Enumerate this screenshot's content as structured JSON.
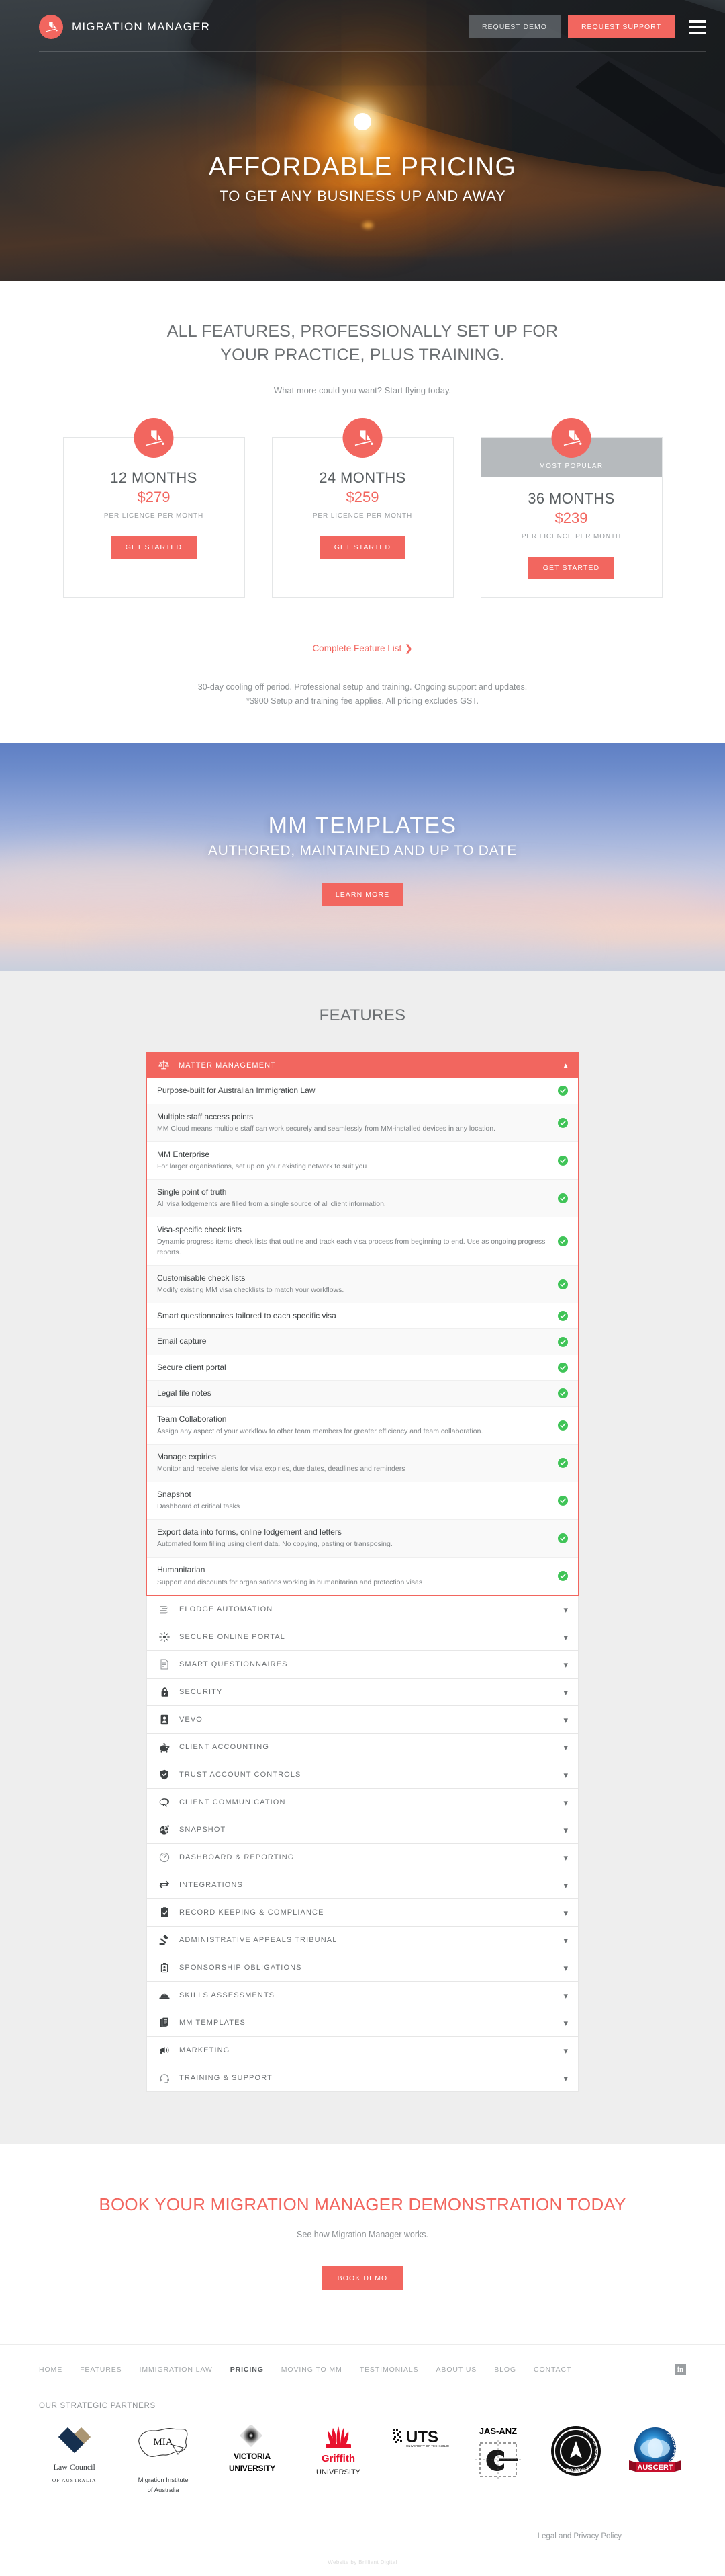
{
  "brand": {
    "name": "MIGRATION MANAGER",
    "accent": "#f2665f"
  },
  "nav": {
    "request_demo": "REQUEST DEMO",
    "request_support": "REQUEST SUPPORT"
  },
  "hero": {
    "title": "AFFORDABLE PRICING",
    "subtitle": "TO GET ANY BUSINESS UP AND AWAY"
  },
  "pricing": {
    "heading_line1": "ALL FEATURES, PROFESSIONALLY SET UP FOR",
    "heading_line2": "YOUR PRACTICE, PLUS TRAINING.",
    "subheading": "What more could you want? Start flying today.",
    "note_unit": "PER LICENCE PER MONTH",
    "cta": "GET STARTED",
    "popular_badge": "MOST POPULAR",
    "cards": [
      {
        "term": "12 MONTHS",
        "price": "$279",
        "note": "PER LICENCE PER MONTH",
        "cta": "GET STARTED",
        "badge": ""
      },
      {
        "term": "24 MONTHS",
        "price": "$259",
        "note": "PER LICENCE PER MONTH",
        "cta": "GET STARTED",
        "badge": ""
      },
      {
        "term": "36 MONTHS",
        "price": "$239",
        "note": "PER LICENCE PER MONTH",
        "cta": "GET STARTED",
        "badge": "MOST POPULAR"
      }
    ],
    "feature_list_link": "Complete Feature List",
    "feature_list_chevron": "❯",
    "fine_line1": "30-day cooling off period. Professional setup and training. Ongoing support and updates.",
    "fine_line2": "*$900 Setup and training fee applies. All pricing excludes GST."
  },
  "templates": {
    "title": "MM TEMPLATES",
    "subtitle": "AUTHORED, MAINTAINED AND UP TO DATE",
    "cta": "LEARN MORE"
  },
  "features": {
    "title": "FEATURES",
    "open_panel": {
      "label": "MATTER MANAGEMENT",
      "icon": "scales-icon",
      "chevron": "⌃",
      "items": [
        {
          "title": "Purpose-built for Australian Immigration Law",
          "desc": ""
        },
        {
          "title": "Multiple staff access points",
          "desc": "MM Cloud means multiple staff can work securely and seamlessly from MM-installed devices in any location."
        },
        {
          "title": "MM Enterprise",
          "desc": "For larger organisations, set up on your existing network to suit you"
        },
        {
          "title": "Single point of truth",
          "desc": "All visa lodgements are filled from a single source of all client information."
        },
        {
          "title": "Visa-specific check lists",
          "desc": "Dynamic progress items check lists that outline and track each visa process from beginning to end. Use as ongoing progress reports."
        },
        {
          "title": "Customisable check lists",
          "desc": "Modify existing MM visa checklists to match your workflows."
        },
        {
          "title": "Smart questionnaires tailored to each specific visa",
          "desc": ""
        },
        {
          "title": "Email capture",
          "desc": ""
        },
        {
          "title": "Secure client portal",
          "desc": ""
        },
        {
          "title": "Legal file notes",
          "desc": ""
        },
        {
          "title": "Team Collaboration",
          "desc": "Assign any aspect of your workflow to other team members for greater efficiency and team collaboration."
        },
        {
          "title": "Manage expiries",
          "desc": "Monitor and receive alerts for visa expiries, due dates, deadlines and reminders"
        },
        {
          "title": "Snapshot",
          "desc": "Dashboard of critical tasks"
        },
        {
          "title": "Export data into forms, online lodgement and letters",
          "desc": "Automated form filling using client data. No copying, pasting or transposing."
        },
        {
          "title": "Humanitarian",
          "desc": "Support and discounts for organisations working in humanitarian and protection visas"
        }
      ]
    },
    "closed_panels": [
      {
        "label": "ELODGE AUTOMATION",
        "icon": "elodge-icon"
      },
      {
        "label": "SECURE ONLINE PORTAL",
        "icon": "burst-icon"
      },
      {
        "label": "SMART QUESTIONNAIRES",
        "icon": "document-icon"
      },
      {
        "label": "SECURITY",
        "icon": "lock-icon"
      },
      {
        "label": "VEVO",
        "icon": "id-card-icon"
      },
      {
        "label": "CLIENT ACCOUNTING",
        "icon": "piggy-bank-icon"
      },
      {
        "label": "TRUST ACCOUNT CONTROLS",
        "icon": "shield-icon"
      },
      {
        "label": "CLIENT COMMUNICATION",
        "icon": "speech-bubble-icon"
      },
      {
        "label": "SNAPSHOT",
        "icon": "camera-shutter-icon"
      },
      {
        "label": "DASHBOARD & REPORTING",
        "icon": "gauge-icon"
      },
      {
        "label": "INTEGRATIONS",
        "icon": "exchange-arrows-icon"
      },
      {
        "label": "RECORD KEEPING & COMPLIANCE",
        "icon": "clipboard-check-icon"
      },
      {
        "label": "ADMINISTRATIVE APPEALS TRIBUNAL",
        "icon": "gavel-icon"
      },
      {
        "label": "SPONSORSHIP OBLIGATIONS",
        "icon": "badge-id-icon"
      },
      {
        "label": "SKILLS ASSESSMENTS",
        "icon": "hard-hat-icon"
      },
      {
        "label": "MM TEMPLATES",
        "icon": "documents-stack-icon"
      },
      {
        "label": "MARKETING",
        "icon": "megaphone-icon"
      },
      {
        "label": "TRAINING & SUPPORT",
        "icon": "headset-icon"
      }
    ],
    "chevron_down": "⌄"
  },
  "book_demo": {
    "title": "BOOK YOUR MIGRATION MANAGER DEMONSTRATION TODAY",
    "subtitle": "See how Migration Manager works.",
    "cta": "BOOK DEMO"
  },
  "footer": {
    "nav": [
      {
        "label": "HOME",
        "active": false
      },
      {
        "label": "FEATURES",
        "active": false
      },
      {
        "label": "IMMIGRATION LAW",
        "active": false
      },
      {
        "label": "PRICING",
        "active": true
      },
      {
        "label": "MOVING TO MM",
        "active": false
      },
      {
        "label": "TESTIMONIALS",
        "active": false
      },
      {
        "label": "ABOUT US",
        "active": false
      },
      {
        "label": "BLOG",
        "active": false
      },
      {
        "label": "CONTACT",
        "active": false
      }
    ],
    "linkedin": "in",
    "partners_label": "OUR STRATEGIC PARTNERS",
    "partners": [
      {
        "name": "Law Council of Australia",
        "line1": "Law Council",
        "line2": "OF AUSTRALIA"
      },
      {
        "name": "Migration Institute of Australia",
        "line1": "MIA",
        "line2": "Migration Institute\nof Australia"
      },
      {
        "name": "Victoria University",
        "line1": "VICTORIA",
        "line2": "UNIVERSITY"
      },
      {
        "name": "Griffith University",
        "line1": "Griffith",
        "line2": "UNIVERSITY"
      },
      {
        "name": "University of Technology Sydney",
        "line1": "UTS",
        "line2": "UNIVERSITY OF TECHNOLOGY SYDNEY"
      },
      {
        "name": "JAS-ANZ",
        "line1": "JAS-ANZ",
        "line2": ""
      },
      {
        "name": "Compass Assurance Services ISO 27001",
        "line1": "COMPASS ASSURANCE SERVICES",
        "line2": "ISO 27001"
      },
      {
        "name": "AusCERT Proud Member",
        "line1": "PROUD MEMBER",
        "line2": "AUSCERT"
      }
    ],
    "legal": "Legal and Privacy Policy",
    "credit": "Website by Brilliant Digital"
  }
}
